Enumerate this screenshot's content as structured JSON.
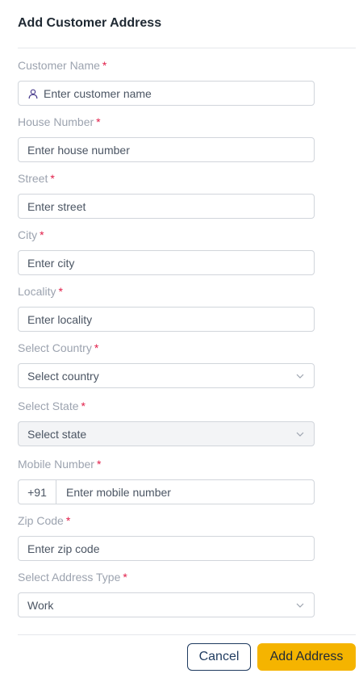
{
  "header": {
    "title": "Add Customer Address"
  },
  "fields": {
    "customer_name": {
      "label": "Customer Name",
      "required": "*",
      "placeholder": "Enter customer name",
      "icon": "user-icon"
    },
    "house_number": {
      "label": "House Number",
      "required": "*",
      "placeholder": "Enter house number"
    },
    "street": {
      "label": "Street",
      "required": "*",
      "placeholder": "Enter street"
    },
    "city": {
      "label": "City",
      "required": "*",
      "placeholder": "Enter city"
    },
    "locality": {
      "label": "Locality",
      "required": "*",
      "placeholder": "Enter locality"
    },
    "country": {
      "label": "Select Country",
      "required": "*",
      "value": "Select country",
      "icon": "chevron-down-icon"
    },
    "state": {
      "label": "Select State",
      "required": "*",
      "value": "Select state",
      "icon": "chevron-down-icon"
    },
    "mobile": {
      "label": "Mobile Number",
      "required": "*",
      "prefix": "+91",
      "placeholder": "Enter mobile number"
    },
    "zip": {
      "label": "Zip Code",
      "required": "*",
      "placeholder": "Enter zip code"
    },
    "address_type": {
      "label": "Select Address Type",
      "required": "*",
      "value": "Work",
      "icon": "chevron-down-icon"
    }
  },
  "actions": {
    "cancel_label": "Cancel",
    "submit_label": "Add Address"
  },
  "colors": {
    "accent": "#f5b400",
    "required": "#e11d48",
    "cancel_border": "#1e3a5f"
  }
}
